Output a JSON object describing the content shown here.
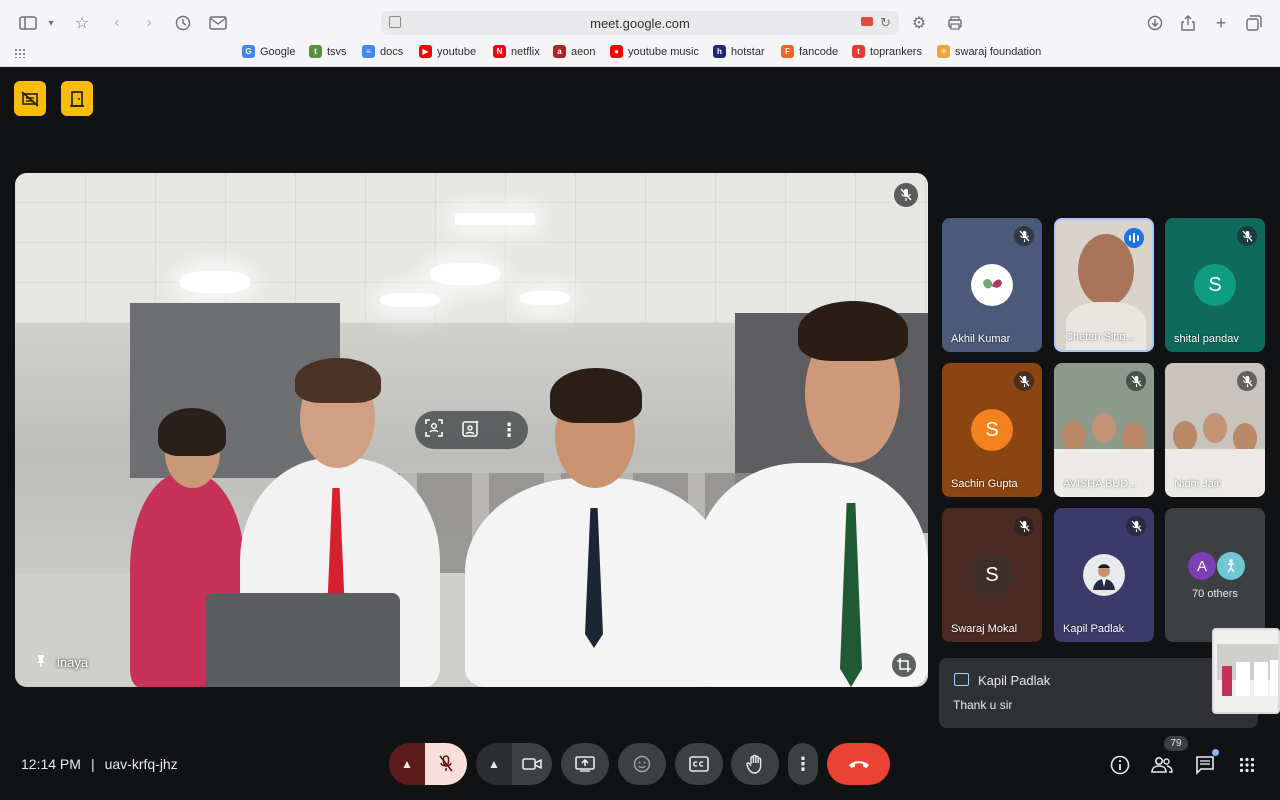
{
  "browser": {
    "url": "meet.google.com",
    "bookmarks": [
      {
        "label": "Google",
        "color": "#4285f4",
        "glyph": "G"
      },
      {
        "label": "tsvs",
        "color": "#5a8f3c",
        "glyph": "t"
      },
      {
        "label": "docs",
        "color": "#4285f4",
        "glyph": "≡"
      },
      {
        "label": "youtube",
        "color": "#ff0000",
        "glyph": "▶"
      },
      {
        "label": "netflix",
        "color": "#e50914",
        "glyph": "N"
      },
      {
        "label": "aeon",
        "color": "#b22222",
        "glyph": "a"
      },
      {
        "label": "youtube music",
        "color": "#ff0000",
        "glyph": "●"
      },
      {
        "label": "hotstar",
        "color": "#1f2b6e",
        "glyph": "h"
      },
      {
        "label": "fancode",
        "color": "#f26522",
        "glyph": "F"
      },
      {
        "label": "toprankers",
        "color": "#e53935",
        "glyph": "t"
      },
      {
        "label": "swaraj foundation",
        "color": "#f2a33a",
        "glyph": "✳"
      }
    ]
  },
  "main_video": {
    "participant_name": "inaya"
  },
  "participants": [
    {
      "name": "Akhil Kumar",
      "avatar_letter": "",
      "bg": "#4b5a78",
      "muted": true
    },
    {
      "name": "Chetan Sing...",
      "avatar_letter": "",
      "bg": "#d9d4cb",
      "muted": false,
      "speaking": true
    },
    {
      "name": "shital pandav",
      "avatar_letter": "S",
      "bg": "#0e6b5c",
      "avatar_bg": "#0f9d82",
      "muted": true
    },
    {
      "name": "Sachin Gupta",
      "avatar_letter": "S",
      "bg": "#8a4510",
      "avatar_bg": "#f4811f",
      "muted": true
    },
    {
      "name": "AVISHA BUD...",
      "avatar_letter": "",
      "bg": "#8b9a8a",
      "muted": true
    },
    {
      "name": "Nidhi Jain",
      "avatar_letter": "",
      "bg": "#c9c3bd",
      "muted": true
    },
    {
      "name": "Swaraj Mokal",
      "avatar_letter": "S",
      "bg": "#4a2a22",
      "avatar_bg": "#3c2f2b",
      "muted": true
    },
    {
      "name": "Kapil Padlak",
      "avatar_letter": "",
      "bg": "#3b3a6b",
      "muted": true
    }
  ],
  "others": {
    "label": "70 others",
    "avatar_letter": "A"
  },
  "chat": {
    "sender": "Kapil Padlak",
    "message": "Thank u sir"
  },
  "meeting": {
    "time": "12:14 PM",
    "separator": "|",
    "code": "uav-krfq-jhz",
    "people_count": "79"
  },
  "colors": {
    "accent_yellow": "#fbbc04",
    "end_call_red": "#ea4335",
    "mic_off_pink": "#f9dedc"
  }
}
